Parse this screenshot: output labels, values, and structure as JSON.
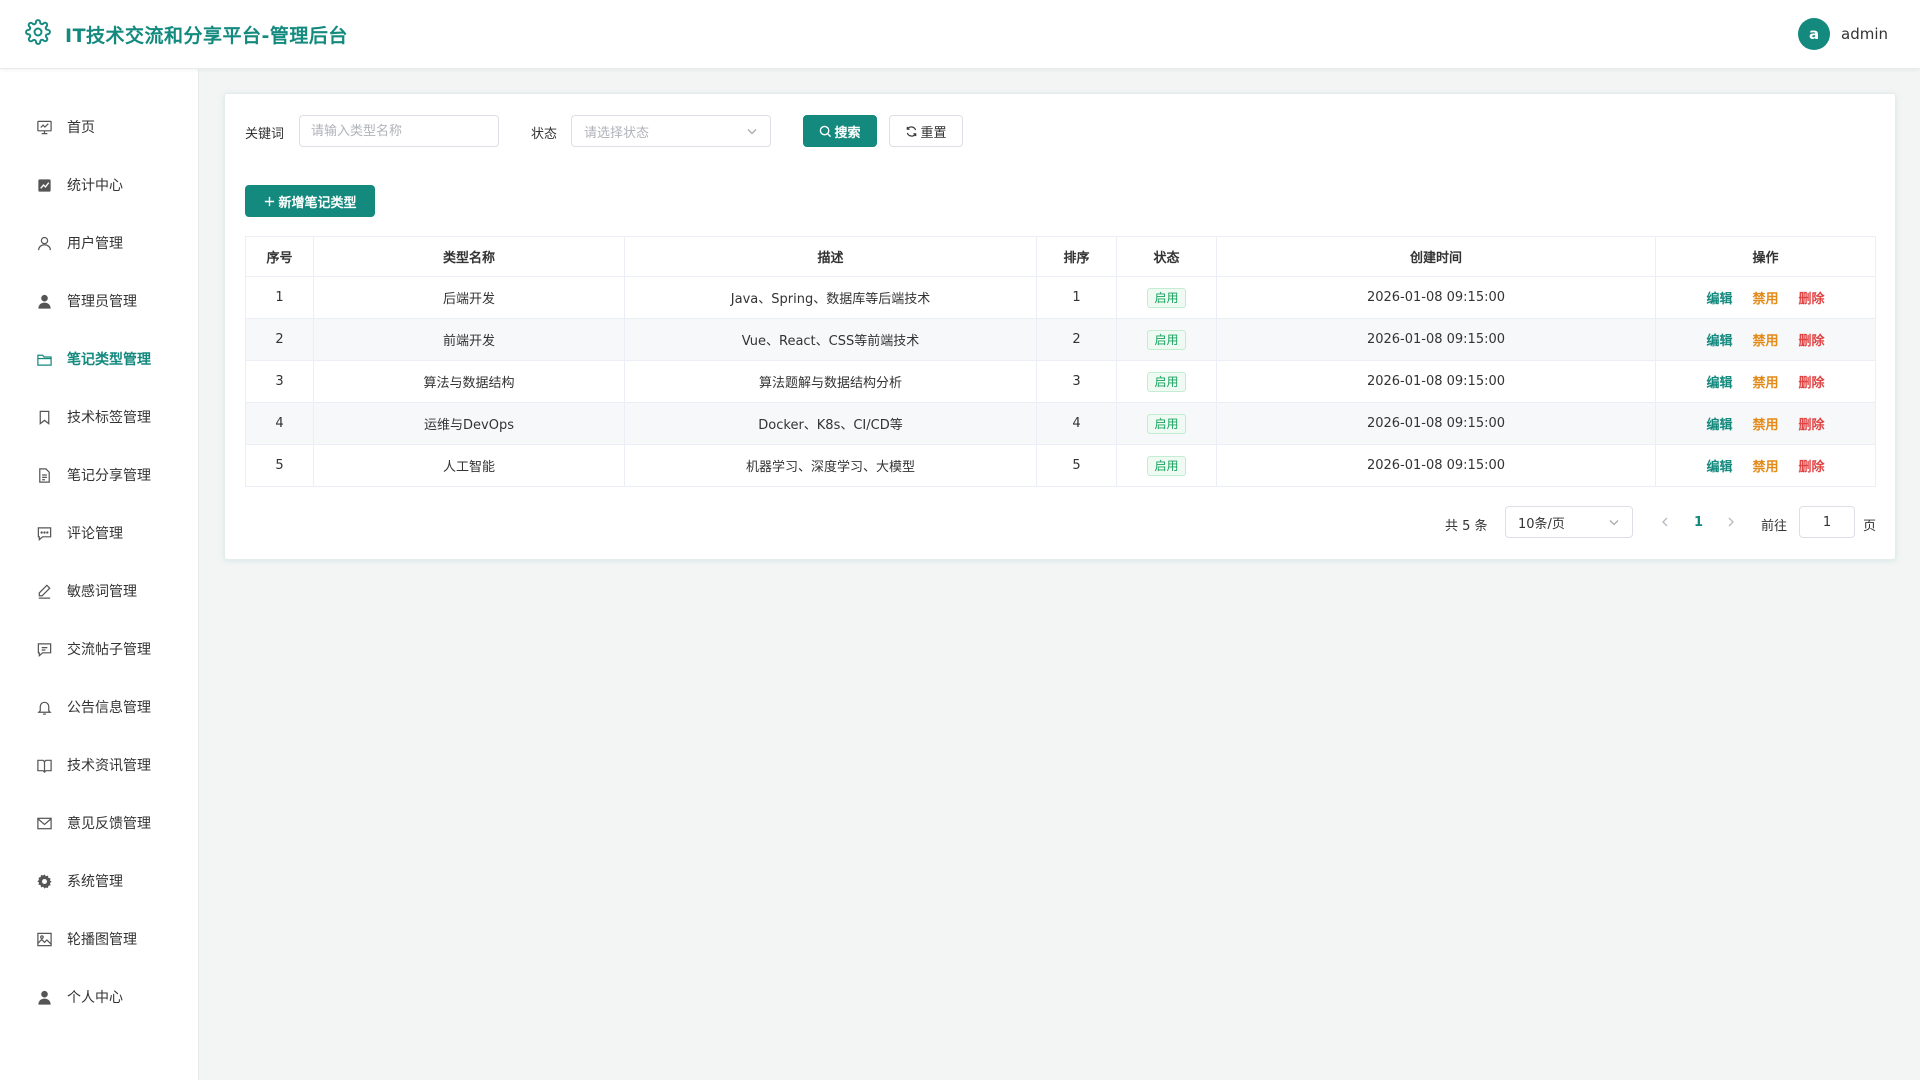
{
  "app": {
    "title": "IT技术交流和分享平台-管理后台"
  },
  "user": {
    "avatar_letter": "a",
    "name": "admin"
  },
  "sidebar": {
    "items": [
      {
        "label": "首页",
        "icon": "home-screen-icon"
      },
      {
        "label": "统计中心",
        "icon": "chart-icon"
      },
      {
        "label": "用户管理",
        "icon": "user-outline-icon"
      },
      {
        "label": "管理员管理",
        "icon": "user-filled-icon"
      },
      {
        "label": "笔记类型管理",
        "icon": "folder-icon",
        "active": true
      },
      {
        "label": "技术标签管理",
        "icon": "bookmark-icon"
      },
      {
        "label": "笔记分享管理",
        "icon": "document-icon"
      },
      {
        "label": "评论管理",
        "icon": "comment-icon"
      },
      {
        "label": "敏感词管理",
        "icon": "pen-icon"
      },
      {
        "label": "交流帖子管理",
        "icon": "message-icon"
      },
      {
        "label": "公告信息管理",
        "icon": "bell-icon"
      },
      {
        "label": "技术资讯管理",
        "icon": "book-icon"
      },
      {
        "label": "意见反馈管理",
        "icon": "mail-icon"
      },
      {
        "label": "系统管理",
        "icon": "gear-icon"
      },
      {
        "label": "轮播图管理",
        "icon": "picture-icon"
      },
      {
        "label": "个人中心",
        "icon": "user-filled-icon"
      }
    ]
  },
  "filters": {
    "keyword_label": "关键词",
    "keyword_placeholder": "请输入类型名称",
    "status_label": "状态",
    "status_placeholder": "请选择状态",
    "search_label": "搜索",
    "reset_label": "重置"
  },
  "actions": {
    "add_label": "新增笔记类型"
  },
  "table": {
    "columns": [
      "序号",
      "类型名称",
      "描述",
      "排序",
      "状态",
      "创建时间",
      "操作"
    ],
    "rows": [
      {
        "index": "1",
        "name": "后端开发",
        "desc": "Java、Spring、数据库等后端技术",
        "sort": "1",
        "status": "启用",
        "created": "2026-01-08 09:15:00"
      },
      {
        "index": "2",
        "name": "前端开发",
        "desc": "Vue、React、CSS等前端技术",
        "sort": "2",
        "status": "启用",
        "created": "2026-01-08 09:15:00"
      },
      {
        "index": "3",
        "name": "算法与数据结构",
        "desc": "算法题解与数据结构分析",
        "sort": "3",
        "status": "启用",
        "created": "2026-01-08 09:15:00"
      },
      {
        "index": "4",
        "name": "运维与DevOps",
        "desc": "Docker、K8s、CI/CD等",
        "sort": "4",
        "status": "启用",
        "created": "2026-01-08 09:15:00"
      },
      {
        "index": "5",
        "name": "人工智能",
        "desc": "机器学习、深度学习、大模型",
        "sort": "5",
        "status": "启用",
        "created": "2026-01-08 09:15:00"
      }
    ],
    "ops": {
      "edit": "编辑",
      "disable": "禁用",
      "delete": "删除"
    }
  },
  "pagination": {
    "total_text": "共 5 条",
    "page_size": "10条/页",
    "current_page": "1",
    "goto_label": "前往",
    "goto_value": "1",
    "page_suffix": "页"
  },
  "colors": {
    "accent": "#148a7f",
    "warning": "#e48a18",
    "danger": "#e04545",
    "success": "#1aa261"
  }
}
